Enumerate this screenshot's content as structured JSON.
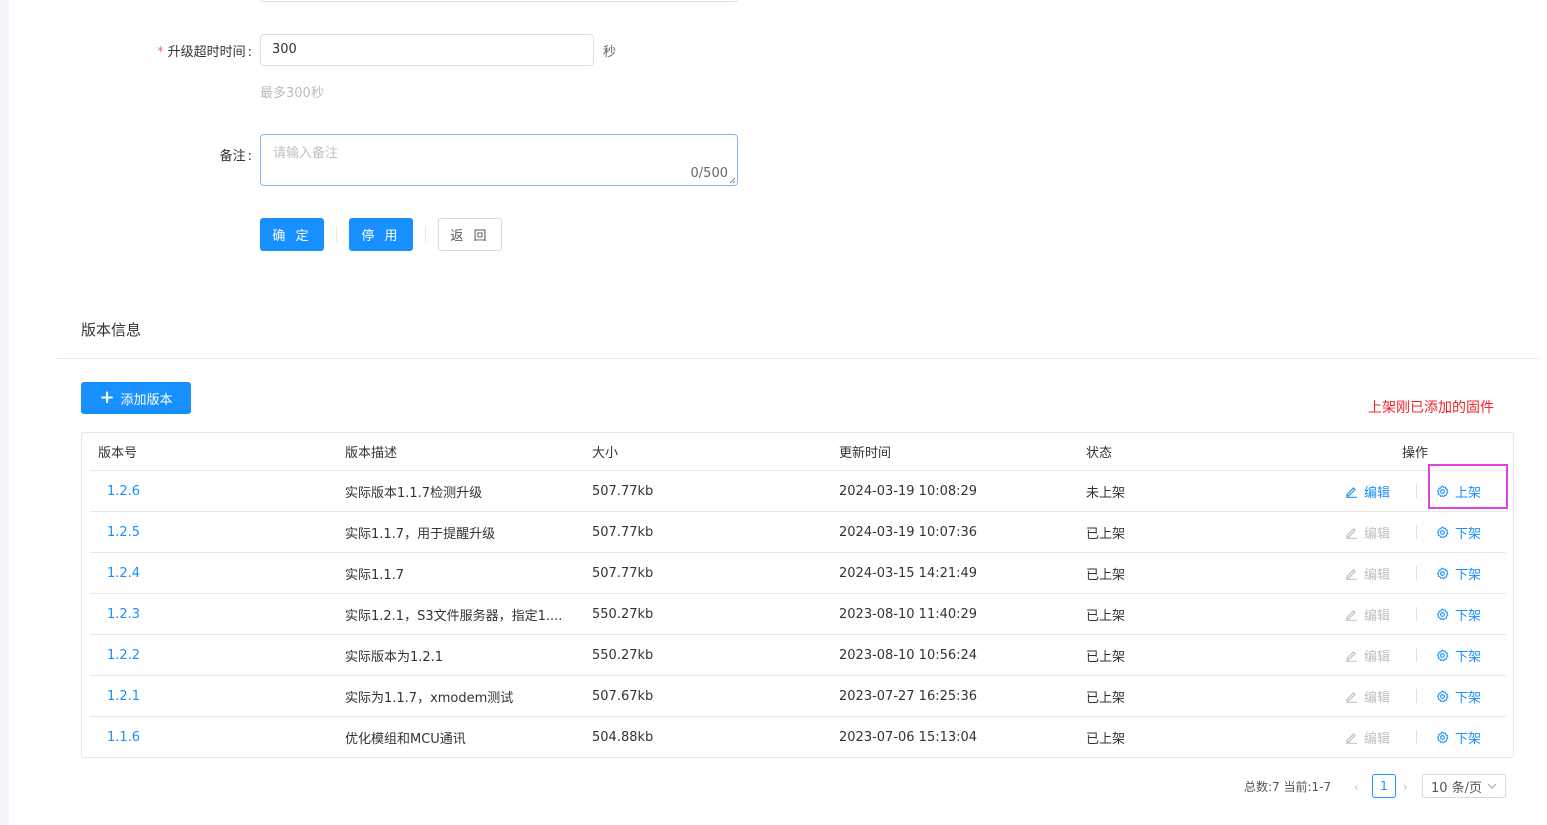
{
  "form": {
    "timeout_label": "升级超时时间",
    "timeout_required_mark": "*",
    "colon": ":",
    "timeout_value": "300",
    "timeout_unit": "秒",
    "timeout_hint": "最多300秒",
    "remark_label": "备注",
    "remark_placeholder": "请输入备注",
    "remark_count": "0/500",
    "confirm_label": "确 定",
    "disable_label": "停 用",
    "back_label": "返 回"
  },
  "versions": {
    "section_title": "版本信息",
    "add_label": "添加版本",
    "annotation": "上架刚已添加的固件",
    "columns": [
      "版本号",
      "版本描述",
      "大小",
      "更新时间",
      "状态",
      "操作"
    ],
    "edit_label": "编辑",
    "rows": [
      {
        "version": "1.2.6",
        "desc": "实际版本1.1.7检测升级",
        "size": "507.77kb",
        "time": "2024-03-19 10:08:29",
        "status": "未上架",
        "action": "上架"
      },
      {
        "version": "1.2.5",
        "desc": "实际1.1.7，用于提醒升级",
        "size": "507.77kb",
        "time": "2024-03-19 10:07:36",
        "status": "已上架",
        "action": "下架"
      },
      {
        "version": "1.2.4",
        "desc": "实际1.1.7",
        "size": "507.77kb",
        "time": "2024-03-15 14:21:49",
        "status": "已上架",
        "action": "下架"
      },
      {
        "version": "1.2.3",
        "desc": "实际1.2.1，S3文件服务器，指定1....",
        "size": "550.27kb",
        "time": "2023-08-10 11:40:29",
        "status": "已上架",
        "action": "下架"
      },
      {
        "version": "1.2.2",
        "desc": "实际版本为1.2.1",
        "size": "550.27kb",
        "time": "2023-08-10 10:56:24",
        "status": "已上架",
        "action": "下架"
      },
      {
        "version": "1.2.1",
        "desc": "实际为1.1.7，xmodem测试",
        "size": "507.67kb",
        "time": "2023-07-27 16:25:36",
        "status": "已上架",
        "action": "下架"
      },
      {
        "version": "1.1.6",
        "desc": "优化模组和MCU通讯",
        "size": "504.88kb",
        "time": "2023-07-06 15:13:04",
        "status": "已上架",
        "action": "下架"
      }
    ]
  },
  "pagination": {
    "summary": "总数:7 当前:1-7",
    "current_page": "1",
    "page_size": "10 条/页"
  },
  "colors": {
    "primary": "#1890ff",
    "annotation": "#f5222d",
    "highlight": "#e040e0"
  }
}
